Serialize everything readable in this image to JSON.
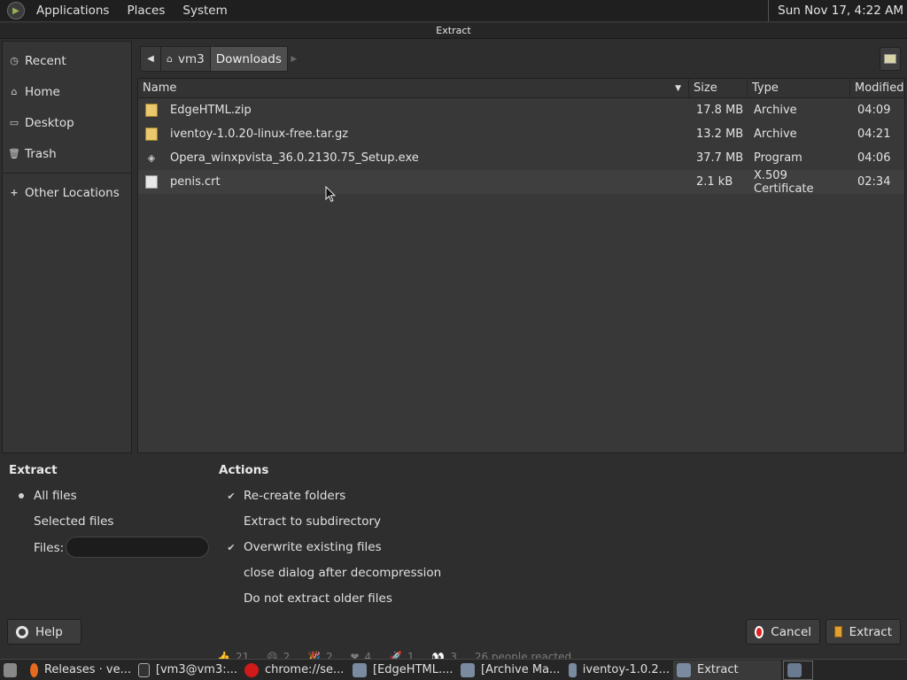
{
  "top_panel": {
    "menus": [
      "Applications",
      "Places",
      "System"
    ],
    "clock": "Sun Nov 17,  4:22 AM"
  },
  "dialog": {
    "title": "Extract"
  },
  "sidebar": {
    "items": [
      {
        "label": "Recent",
        "icon": "recent-icon"
      },
      {
        "label": "Home",
        "icon": "home-folder-icon"
      },
      {
        "label": "Desktop",
        "icon": "desktop-folder-icon"
      },
      {
        "label": "Trash",
        "icon": "trash-icon"
      }
    ],
    "other_locations": "Other Locations"
  },
  "pathbar": {
    "segments": [
      "vm3",
      "Downloads"
    ],
    "active": "Downloads"
  },
  "filelist": {
    "columns": [
      "Name",
      "Size",
      "Type",
      "Modified"
    ],
    "rows": [
      {
        "name": "EdgeHTML.zip",
        "size": "17.8 MB",
        "type": "Archive",
        "modified": "04:09",
        "icon": "archive-icon"
      },
      {
        "name": "iventoy-1.0.20-linux-free.tar.gz",
        "size": "13.2 MB",
        "type": "Archive",
        "modified": "04:21",
        "icon": "archive-icon"
      },
      {
        "name": "Opera_winxpvista_36.0.2130.75_Setup.exe",
        "size": "37.7 MB",
        "type": "Program",
        "modified": "04:06",
        "icon": "executable-icon"
      },
      {
        "name": "penis.crt",
        "size": "2.1 kB",
        "type": "X.509 Certificate",
        "modified": "02:34",
        "icon": "document-icon"
      }
    ]
  },
  "extract": {
    "title": "Extract",
    "all_files": "All files",
    "selected_files": "Selected files",
    "files": "Files:",
    "files_value": ""
  },
  "actions": {
    "title": "Actions",
    "recreate_folders": "Re-create folders",
    "extract_subdir": "Extract to subdirectory",
    "overwrite": "Overwrite existing files",
    "close_dialog": "close dialog after decompression",
    "no_older": "Do not extract older files"
  },
  "buttons": {
    "help": "Help",
    "cancel": "Cancel",
    "extract": "Extract"
  },
  "taskbar": {
    "tasks": [
      "Releases · ve...",
      "[vm3@vm3:...",
      "chrome://se...",
      "[EdgeHTML....",
      "[Archive Ma...",
      "iventoy-1.0.2...",
      "Extract"
    ]
  },
  "reactions": {
    "counts": [
      "21",
      "2",
      "2",
      "4",
      "1",
      "3"
    ],
    "summary": "26 people reacted"
  }
}
